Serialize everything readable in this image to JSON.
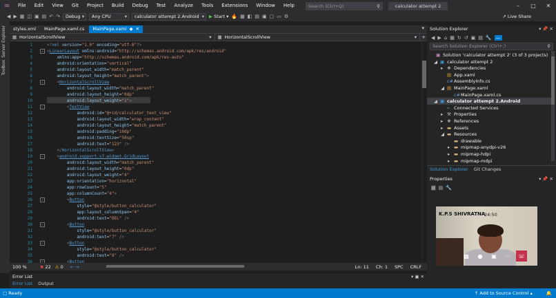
{
  "titlebar": {
    "menus": [
      "File",
      "Edit",
      "View",
      "Git",
      "Project",
      "Build",
      "Debug",
      "Test",
      "Analyze",
      "Tools",
      "Extensions",
      "Window",
      "Help"
    ],
    "search_placeholder": "Search (Ctrl+Q)",
    "solution_title": "calculator attempt 2"
  },
  "toolbar": {
    "config": "Debug",
    "platform": "Any CPU",
    "startup_project": "calculator attempt 2.Android",
    "start_label": "Start",
    "live_share": "Live Share"
  },
  "left_strip": {
    "tabs": [
      "Server Explorer",
      "Toolbox"
    ]
  },
  "doc_tabs": [
    {
      "label": "styles.xml",
      "active": false
    },
    {
      "label": "MainPage.xaml.cs",
      "active": false
    },
    {
      "label": "MainPage.xaml",
      "active": true
    }
  ],
  "navbar": {
    "left": "HorizontalScrollView",
    "right": "HorizontalScrollView"
  },
  "editor": {
    "lines": [
      [
        [
          "punc",
          "<?"
        ],
        [
          "tag",
          "xml"
        ],
        [
          "attr",
          " version"
        ],
        [
          "eq",
          "="
        ],
        [
          "val",
          "\"1.0\""
        ],
        [
          "attr",
          " encoding"
        ],
        [
          "eq",
          "="
        ],
        [
          "val",
          "\"utf-8\""
        ],
        [
          "punc",
          "?>"
        ]
      ],
      [
        [
          "punc",
          "<"
        ],
        [
          "tagu",
          "LinearLayout"
        ],
        [
          "attr",
          " xmlns:android"
        ],
        [
          "eq",
          "="
        ],
        [
          "val",
          "\"http://schemas.android.com/apk/res/android\""
        ]
      ],
      [
        [
          "attr",
          "    xmlns:app"
        ],
        [
          "eq",
          "="
        ],
        [
          "val",
          "\"http://schemas.android.com/apk/res-auto\""
        ]
      ],
      [
        [
          "attr",
          "    android:orientation"
        ],
        [
          "eq",
          "="
        ],
        [
          "val",
          "\"vertical\""
        ]
      ],
      [
        [
          "attr",
          "    android:layout_width"
        ],
        [
          "eq",
          "="
        ],
        [
          "val",
          "\"match_parent\""
        ]
      ],
      [
        [
          "attr",
          "    android:layout_height"
        ],
        [
          "eq",
          "="
        ],
        [
          "val",
          "\"match_parent\""
        ],
        [
          "punc",
          ">"
        ]
      ],
      [
        [
          "punc",
          "    <"
        ],
        [
          "tagu",
          "HorizontalScrollView"
        ]
      ],
      [
        [
          "attr",
          "        android:layout_width"
        ],
        [
          "eq",
          "="
        ],
        [
          "val",
          "\"match_parent\""
        ]
      ],
      [
        [
          "attr",
          "        android:layout_height"
        ],
        [
          "eq",
          "="
        ],
        [
          "val",
          "\"0dp\""
        ]
      ],
      [
        [
          "attr",
          "        android:layout_weight"
        ],
        [
          "eq",
          "="
        ],
        [
          "val",
          "\"1\""
        ],
        [
          "punc",
          ">"
        ]
      ],
      [
        [
          "punc",
          "        <"
        ],
        [
          "tagu",
          "TextView"
        ]
      ],
      [
        [
          "attr",
          "            android:id"
        ],
        [
          "eq",
          "="
        ],
        [
          "val",
          "\"@+id/calculator_text_view\""
        ]
      ],
      [
        [
          "attr",
          "            android:layout_width"
        ],
        [
          "eq",
          "="
        ],
        [
          "val",
          "\"wrap_content\""
        ]
      ],
      [
        [
          "attr",
          "            android:layout_height"
        ],
        [
          "eq",
          "="
        ],
        [
          "val",
          "\"match_parent\""
        ]
      ],
      [
        [
          "attr",
          "            android:padding"
        ],
        [
          "eq",
          "="
        ],
        [
          "val",
          "\"10dp\""
        ]
      ],
      [
        [
          "attr",
          "            android:textSize"
        ],
        [
          "eq",
          "="
        ],
        [
          "val",
          "\"50sp\""
        ]
      ],
      [
        [
          "attr",
          "            android:text"
        ],
        [
          "eq",
          "="
        ],
        [
          "val",
          "\"123\""
        ],
        [
          "punc",
          " />"
        ]
      ],
      [
        [
          "punc",
          "    </"
        ],
        [
          "tag",
          "HorizontalScrollView"
        ],
        [
          "punc",
          ">"
        ]
      ],
      [
        [
          "punc",
          "    <"
        ],
        [
          "tagu",
          "android.support.v7.widget.GridLayout"
        ]
      ],
      [
        [
          "attr",
          "        android:layout_width"
        ],
        [
          "eq",
          "="
        ],
        [
          "val",
          "\"match_parent\""
        ]
      ],
      [
        [
          "attr",
          "        android:layout_height"
        ],
        [
          "eq",
          "="
        ],
        [
          "val",
          "\"0dp\""
        ]
      ],
      [
        [
          "attr",
          "        android:layout_weight"
        ],
        [
          "eq",
          "="
        ],
        [
          "val",
          "\"4\""
        ]
      ],
      [
        [
          "attr",
          "        app:orientation"
        ],
        [
          "eq",
          "="
        ],
        [
          "val",
          "\"horizontal\""
        ]
      ],
      [
        [
          "attr",
          "        app:rowCount"
        ],
        [
          "eq",
          "="
        ],
        [
          "val",
          "\"5\""
        ]
      ],
      [
        [
          "attr",
          "        app:columnCount"
        ],
        [
          "eq",
          "="
        ],
        [
          "val",
          "\"4\""
        ],
        [
          "punc",
          ">"
        ]
      ],
      [
        [
          "punc",
          "        <"
        ],
        [
          "tagu",
          "Button"
        ]
      ],
      [
        [
          "attr",
          "            style"
        ],
        [
          "eq",
          "="
        ],
        [
          "val",
          "\"@style/button_calculator\""
        ]
      ],
      [
        [
          "attr",
          "            app:layout_columnSpan"
        ],
        [
          "eq",
          "="
        ],
        [
          "val",
          "\"4\""
        ]
      ],
      [
        [
          "attr",
          "            android:text"
        ],
        [
          "eq",
          "="
        ],
        [
          "val",
          "\"DEL\""
        ],
        [
          "punc",
          " />"
        ]
      ],
      [
        [
          "punc",
          "        <"
        ],
        [
          "tagu",
          "Button"
        ]
      ],
      [
        [
          "attr",
          "            style"
        ],
        [
          "eq",
          "="
        ],
        [
          "val",
          "\"@style/button_calculator\""
        ]
      ],
      [
        [
          "attr",
          "            android:text"
        ],
        [
          "eq",
          "="
        ],
        [
          "val",
          "\"7\""
        ],
        [
          "punc",
          " />"
        ]
      ],
      [
        [
          "punc",
          "        <"
        ],
        [
          "tagu",
          "Button"
        ]
      ],
      [
        [
          "attr",
          "            style"
        ],
        [
          "eq",
          "="
        ],
        [
          "val",
          "\"@style/button_calculator\""
        ]
      ],
      [
        [
          "attr",
          "            android:text"
        ],
        [
          "eq",
          "="
        ],
        [
          "val",
          "\"8\""
        ],
        [
          "punc",
          " />"
        ]
      ],
      [
        [
          "punc",
          "        <"
        ],
        [
          "tagu",
          "Button"
        ]
      ]
    ]
  },
  "editor_status": {
    "zoom": "100 %",
    "errors": "22",
    "warnings": "0",
    "line": "Ln: 11",
    "col": "Ch: 1",
    "spc": "SPC",
    "crlf": "CRLF"
  },
  "error_list": {
    "title": "Error List",
    "tabs": [
      "Error List",
      "Output"
    ]
  },
  "solution_explorer": {
    "title": "Solution Explorer",
    "search_placeholder": "Search Solution Explorer (Ctrl+;)",
    "items": [
      {
        "label": "Solution 'calculator attempt 2' (3 of 3 projects)",
        "bold": false,
        "icon": "solution-icon"
      },
      {
        "label": "calculator attempt 2",
        "bold": false,
        "icon": "project-icon"
      },
      {
        "label": "Dependencies",
        "bold": false,
        "icon": "dependencies-icon"
      },
      {
        "label": "App.xaml",
        "bold": false,
        "icon": "xaml-icon"
      },
      {
        "label": "AssemblyInfo.cs",
        "bold": false,
        "icon": "csharp-icon"
      },
      {
        "label": "MainPage.xaml",
        "bold": false,
        "icon": "xaml-icon"
      },
      {
        "label": "MainPage.xaml.cs",
        "bold": false,
        "icon": "csharp-icon"
      },
      {
        "label": "calculator attempt 2.Android",
        "bold": true,
        "icon": "project-icon"
      },
      {
        "label": "Connected Services",
        "bold": false,
        "icon": "connected-icon"
      },
      {
        "label": "Properties",
        "bold": false,
        "icon": "wrench-icon"
      },
      {
        "label": "References",
        "bold": false,
        "icon": "references-icon"
      },
      {
        "label": "Assets",
        "bold": false,
        "icon": "folder-icon"
      },
      {
        "label": "Resources",
        "bold": false,
        "icon": "folder-icon"
      },
      {
        "label": "drawable",
        "bold": false,
        "icon": "folder-icon"
      },
      {
        "label": "mipmap-anydpi-v26",
        "bold": false,
        "icon": "folder-icon"
      },
      {
        "label": "mipmap-hdpi",
        "bold": false,
        "icon": "folder-icon"
      },
      {
        "label": "mipmap-mdpi",
        "bold": false,
        "icon": "folder-icon"
      },
      {
        "label": "mipmap-xhdpi",
        "bold": false,
        "icon": "folder-icon"
      }
    ],
    "tabs": [
      "Solution Explorer",
      "Git Changes"
    ]
  },
  "properties": {
    "title": "Properties"
  },
  "video_call": {
    "name": "K.P.S SHIVRATNA",
    "time": "24:50"
  },
  "statusbar": {
    "ready": "Ready",
    "add_source": "Add to Source Control"
  },
  "colors": {
    "accent": "#007acc",
    "error": "#f14c4c",
    "warning": "#ffcc00",
    "end_call": "#c4314b"
  }
}
